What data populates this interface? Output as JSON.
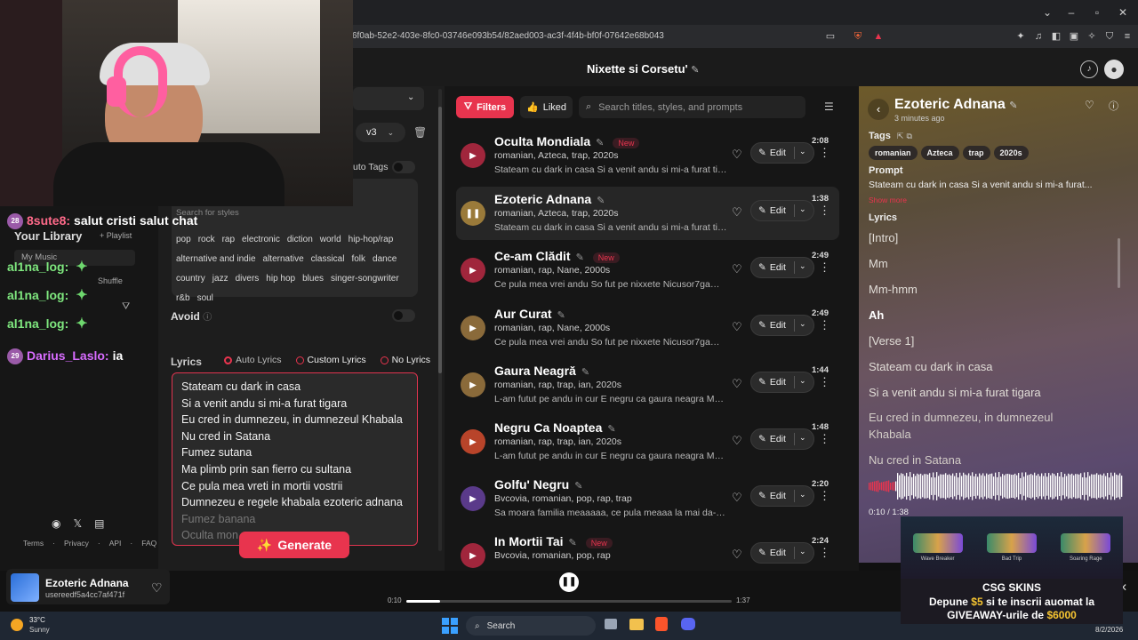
{
  "browser": {
    "url": "6f0ab-52e2-403e-8fc0-03746e093b54/82aed003-ac3f-4f4b-bf0f-07642e68b043"
  },
  "header": {
    "title": "Nixette si Corsetu'"
  },
  "chat": {
    "messages": [
      {
        "badge": "28",
        "user": "8sute8:",
        "text": "salut cristi salut chat",
        "user_color": "#ff6a8a"
      },
      {
        "user": "al1na_log:",
        "text": "",
        "user_color": "#7fe87f"
      },
      {
        "user": "al1na_log:",
        "text": "",
        "user_color": "#7fe87f"
      },
      {
        "user": "al1na_log:",
        "text": "",
        "user_color": "#7fe87f"
      },
      {
        "badge": "29",
        "user": "Darius_Laslo:",
        "text": "ia",
        "user_color": "#d86cff"
      }
    ]
  },
  "left": {
    "version": "v3",
    "auto_tags_label": "uto Tags",
    "style_search_placeholder": "Search for styles",
    "styles": [
      "pop",
      "rock",
      "rap",
      "electronic",
      "diction",
      "world",
      "hip-hop/rap",
      "alternative and indie",
      "alternative",
      "classical",
      "folk",
      "dance",
      "country",
      "jazz",
      "divers",
      "hip hop",
      "blues",
      "singer-songwriter",
      "r&b",
      "soul"
    ],
    "avoid_label": "Avoid",
    "library_title": "Your Library",
    "library_playlist": "+ Playlist",
    "library_filter": "My Music",
    "library_shuffle": "Shuffle",
    "lyrics_label": "Lyrics",
    "lyrics_options": [
      "Auto Lyrics",
      "Custom Lyrics",
      "No Lyrics"
    ],
    "lyrics_text": [
      "Stateam cu dark in casa",
      "Si a venit andu si mi-a furat tigara",
      "Eu cred in dumnezeu, in dumnezeul Khabala",
      "Nu cred in Satana",
      "Fumez sutana",
      "Ma plimb prin san fierro cu sultana",
      "Ce pula mea vreti in mortii vostrii",
      "Dumnezeu e regele khabala ezoteric adnana",
      "Fumez banana",
      "Oculta mon"
    ],
    "generate_label": "Generate",
    "footer_links": [
      "Terms",
      "Privacy",
      "API",
      "FAQ"
    ]
  },
  "filters": {
    "filters_label": "Filters",
    "liked_label": "Liked",
    "search_placeholder": "Search titles, styles, and prompts"
  },
  "songs": [
    {
      "title": "Oculta Mondiala",
      "new": "New",
      "style": "romanian, Azteca, trap, 2020s",
      "lyrics": "Stateam cu dark in casa Si a venit andu si mi-a furat tigara Eu cred",
      "duration": "2:08",
      "edit": "Edit",
      "playing": false,
      "color": "#a0263c"
    },
    {
      "title": "Ezoteric Adnana",
      "new": "",
      "style": "romanian, Azteca, trap, 2020s",
      "lyrics": "Stateam cu dark in casa Si a venit andu si mi-a furat tigara Eu cred",
      "duration": "1:38",
      "edit": "Edit",
      "playing": true,
      "color": "#9a7a3a"
    },
    {
      "title": "Ce-am Clădit",
      "new": "New",
      "style": "romanian, rap, Nane, 2000s",
      "lyrics": "Ce pula mea vrei andu So fut pe nixxete Nicusor7gaming Nane",
      "duration": "2:49",
      "edit": "Edit",
      "playing": false,
      "color": "#a0263c"
    },
    {
      "title": "Aur Curat",
      "new": "",
      "style": "romanian, rap, Nane, 2000s",
      "lyrics": "Ce pula mea vrei andu So fut pe nixxete Nicusor7gaming Nane",
      "duration": "2:49",
      "edit": "Edit",
      "playing": false,
      "color": "#8a6a3a"
    },
    {
      "title": "Gaura Neagră",
      "new": "",
      "style": "romanian, rap, trap, ian, 2020s",
      "lyrics": "L-am futut pe andu in cur E negru ca gaura neagra Maica-sa",
      "duration": "1:44",
      "edit": "Edit",
      "playing": false,
      "color": "#8a6a3a"
    },
    {
      "title": "Negru Ca Noaptea",
      "new": "",
      "style": "romanian, rap, trap, ian, 2020s",
      "lyrics": "L-am futut pe andu in cur E negru ca gaura neagra Maica-sa",
      "duration": "1:48",
      "edit": "Edit",
      "playing": false,
      "color": "#b8442a"
    },
    {
      "title": "Golfu' Negru",
      "new": "",
      "style": "Bvcovia, romanian, pop, rap, trap",
      "lyrics": "Sa moara familia meaaaaa, ce pula meaaa la mai da-te n",
      "duration": "2:20",
      "edit": "Edit",
      "playing": false,
      "color": "#5a3a8a"
    },
    {
      "title": "In Mortii Tai",
      "new": "New",
      "style": "Bvcovia, romanian, pop, rap",
      "lyrics": "",
      "duration": "2:24",
      "edit": "Edit",
      "playing": false,
      "color": "#a0263c"
    }
  ],
  "detail": {
    "title": "Ezoteric Adnana",
    "time_ago": "3 minutes ago",
    "tags_label": "Tags",
    "tags": [
      "romanian",
      "Azteca",
      "trap",
      "2020s"
    ],
    "prompt_label": "Prompt",
    "prompt_text": "Stateam cu dark in casa Si a venit andu si mi-a furat...",
    "show_more": "Show more",
    "lyrics_label": "Lyrics",
    "lyrics": [
      "[Intro]",
      "Mm",
      "Mm-hmm",
      "Ah",
      "[Verse 1]",
      "Stateam cu dark in casa",
      "Si a venit andu si mi-a furat tigara",
      "Eu cred in dumnezeu, in dumnezeul",
      "Khabala",
      "Nu cred in Satana"
    ],
    "time": "0:10 / 1:38",
    "progress": 0.102
  },
  "player": {
    "title": "Ezoteric Adnana",
    "user": "usereedf5a4cc7af471f",
    "elapsed": "0:10",
    "total": "1:37",
    "progress": 0.103
  },
  "promo": {
    "brand": "CSG SKINS",
    "line1_pre": "Depune ",
    "line1_amount": "$5",
    "line1_post": " si te inscrii auomat la",
    "line2_pre": "GIVEAWAY-urile de ",
    "line2_amount": "$6000",
    "skins": [
      "Wave Breaker",
      "Bad Trip",
      "Soaring Rage"
    ]
  },
  "taskbar": {
    "weather_temp": "33°C",
    "weather_text": "Sunny",
    "search_label": "Search",
    "date": "8/2/2026"
  },
  "colors": {
    "accent": "#e8344e",
    "money": "#f7c531"
  }
}
